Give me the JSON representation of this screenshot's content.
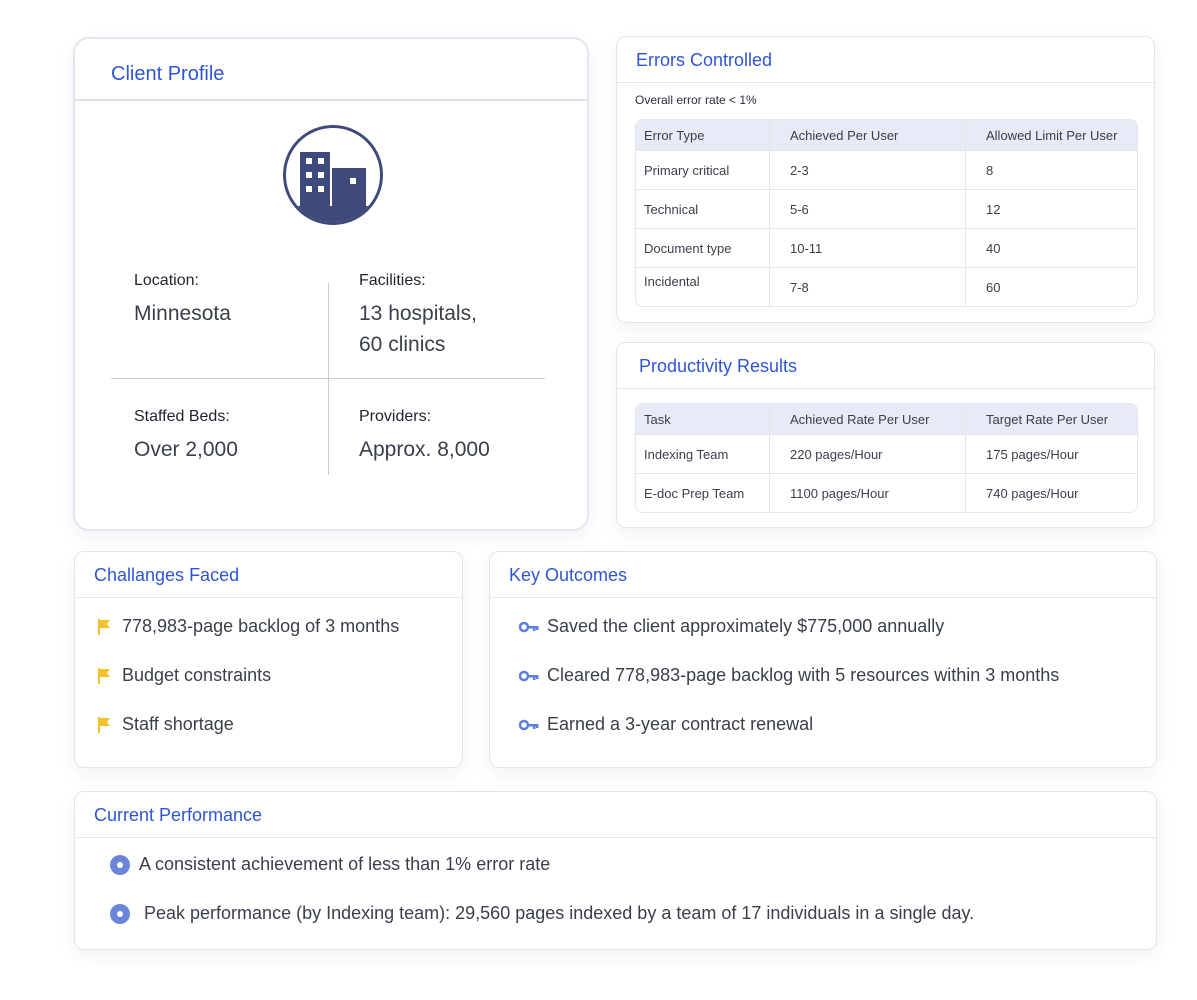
{
  "client_profile": {
    "title": "Client Profile",
    "icon": "building-icon",
    "location": {
      "label": "Location:",
      "value": "Minnesota"
    },
    "facilities": {
      "label": "Facilities:",
      "value_line1": "13 hospitals,",
      "value_line2": "60 clinics"
    },
    "staffed_beds": {
      "label": "Staffed Beds:",
      "value": "Over 2,000"
    },
    "providers": {
      "label": "Providers:",
      "value": "Approx. 8,000"
    }
  },
  "errors_controlled": {
    "title": "Errors Controlled",
    "note": "Overall error rate < 1%",
    "headers": [
      "Error Type",
      "Achieved Per User",
      "Allowed Limit Per User"
    ],
    "rows": [
      [
        "Primary critical",
        "2-3",
        "8"
      ],
      [
        "Technical",
        "5-6",
        "12"
      ],
      [
        "Document type",
        "10-11",
        "40"
      ],
      [
        "Incidental",
        "7-8",
        "60"
      ]
    ]
  },
  "productivity_results": {
    "title": "Productivity Results",
    "headers": [
      "Task",
      "Achieved Rate Per User",
      "Target Rate Per User"
    ],
    "rows": [
      [
        "Indexing Team",
        "220 pages/Hour",
        "175 pages/Hour"
      ],
      [
        "E-doc Prep Team",
        "1100 pages/Hour",
        "740 pages/Hour"
      ]
    ]
  },
  "challenges": {
    "title": "Challanges Faced",
    "items": [
      "778,983-page backlog of 3 months",
      "Budget constraints",
      "Staff shortage"
    ],
    "icon": "flag-icon",
    "icon_color": "#f2c12e"
  },
  "key_outcomes": {
    "title": "Key Outcomes",
    "items": [
      "Saved the client approximately $775,000 annually",
      "Cleared 778,983-page backlog with 5 resources within 3 months",
      "Earned a 3-year contract renewal"
    ],
    "icon": "key-icon",
    "icon_color": "#5b7fe0"
  },
  "current_performance": {
    "title": "Current Performance",
    "items": [
      "A consistent achievement of less than 1% error rate",
      "Peak performance (by Indexing team): 29,560 pages indexed by a team of 17 individuals in a single day."
    ],
    "icon": "bullet-dot-icon",
    "icon_color": "#6b86d8"
  },
  "colors": {
    "accent": "#2f55d4",
    "building": "#3e4a7c",
    "table_header": "#e8ebf6"
  }
}
